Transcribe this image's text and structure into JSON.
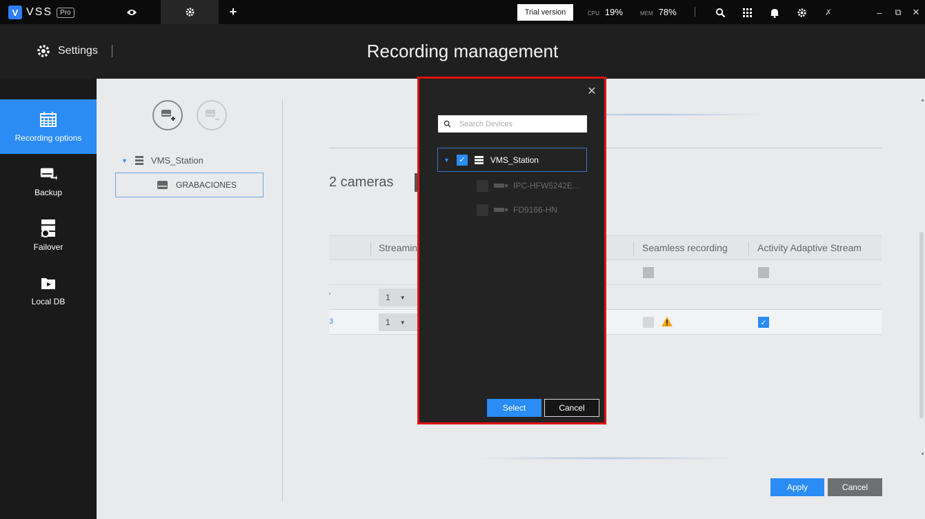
{
  "topbar": {
    "logo_text": "VSS",
    "logo_badge": "Pro",
    "trial_label": "Trial version",
    "cpu_label": "CPU",
    "cpu_value": "19%",
    "mem_label": "MEM",
    "mem_value": "78%"
  },
  "header": {
    "section_label": "Settings",
    "page_title": "Recording management"
  },
  "sidebar": {
    "items": [
      {
        "label": "Recording options",
        "icon": "calendar-icon",
        "active": true
      },
      {
        "label": "Backup",
        "icon": "backup-icon",
        "active": false
      },
      {
        "label": "Failover",
        "icon": "failover-icon",
        "active": false
      },
      {
        "label": "Local DB",
        "icon": "folder-video-icon",
        "active": false
      }
    ]
  },
  "left_tree": {
    "root_label": "VMS_Station",
    "group_label": "GRABACIONES"
  },
  "main": {
    "camera_count": "2 cameras",
    "columns": [
      "Streamin",
      "Seamless recording",
      "Activity Adaptive Stream"
    ],
    "rows": [
      {
        "mark": "",
        "stream": "",
        "seamless_checked": false,
        "adaptive_checked": false
      },
      {
        "mark": "'",
        "stream": "1",
        "seamless_checked": null,
        "adaptive_checked": null
      },
      {
        "mark": "3",
        "stream": "1",
        "seamless_checked": false,
        "seamless_warning": true,
        "adaptive_checked": true
      }
    ],
    "apply_label": "Apply",
    "cancel_label": "Cancel"
  },
  "modal": {
    "search_placeholder": "Search Devices",
    "root_label": "VMS_Station",
    "devices": [
      {
        "name": "IPC-HFW5242E...",
        "checked": false
      },
      {
        "name": "FD9166-HN",
        "checked": false
      }
    ],
    "select_label": "Select",
    "cancel_label": "Cancel",
    "accent": "#2a8cf4",
    "highlight_border": "#e01212"
  }
}
